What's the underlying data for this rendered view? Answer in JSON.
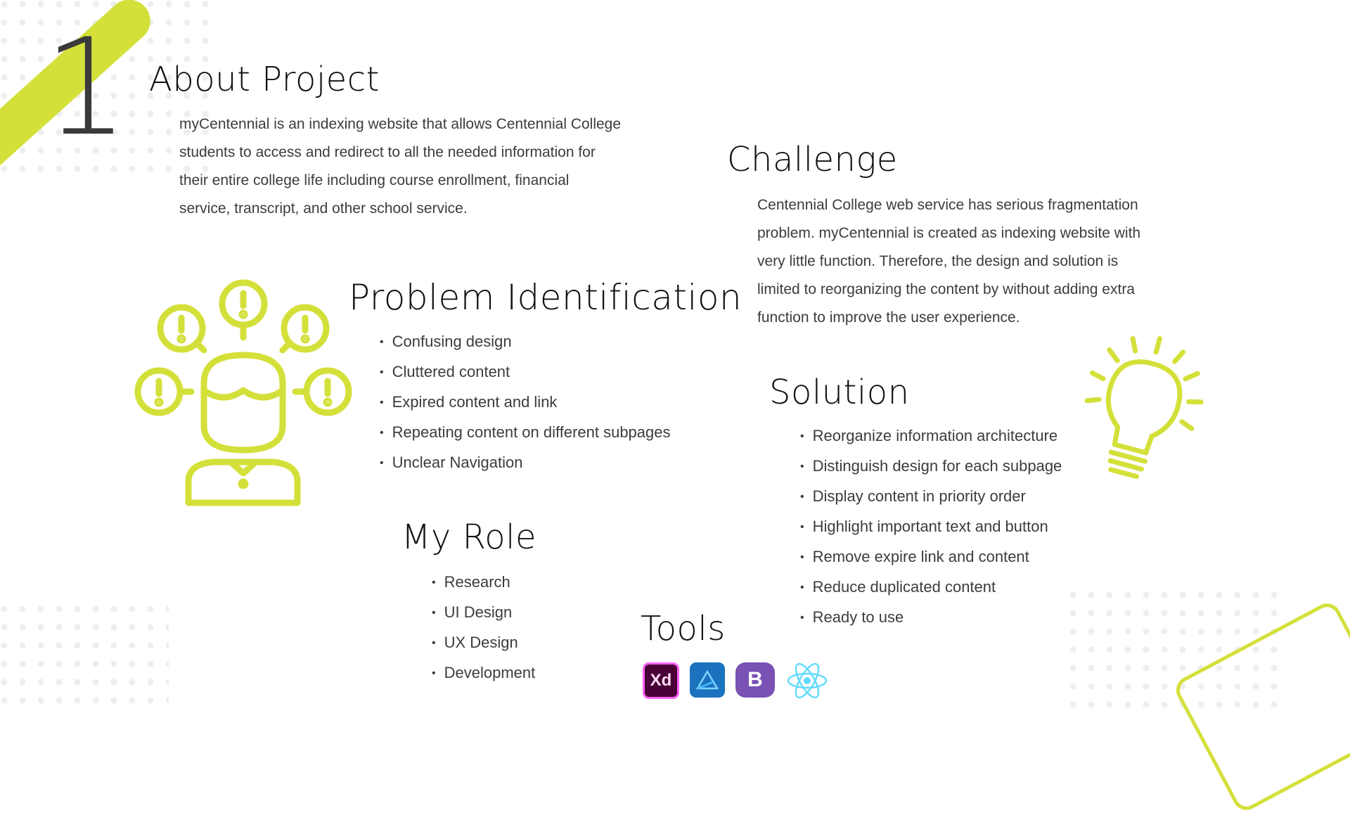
{
  "section_number": "1",
  "about": {
    "title": "About Project",
    "lines": [
      "myCentennial is an indexing website that allows Centennial College",
      "students to access and redirect to all the needed information for",
      "their entire college life including course enrollment, financial",
      "service, transcript, and other school service."
    ]
  },
  "challenge": {
    "title": "Challenge",
    "lines": [
      "Centennial College web service has serious fragmentation",
      "problem. myCentennial is created as indexing website with",
      "very little function. Therefore, the design and solution is",
      "limited to reorganizing the content by without adding extra",
      "function to improve the user experience."
    ]
  },
  "problem": {
    "title": "Problem Identification",
    "items": [
      "Confusing design",
      "Cluttered content",
      "Expired content and link",
      "Repeating content on different subpages",
      "Unclear Navigation"
    ]
  },
  "solution": {
    "title": "Solution",
    "items": [
      "Reorganize information architecture",
      "Distinguish design for each subpage",
      "Display content in priority order",
      "Highlight important text and button",
      "Remove expire link and content",
      "Reduce duplicated content",
      "Ready to use"
    ]
  },
  "role": {
    "title": "My Role",
    "items": [
      "Research",
      "UI Design",
      "UX Design",
      "Development"
    ]
  },
  "tools": {
    "title": "Tools",
    "icons": [
      {
        "name": "adobe-xd-icon",
        "label": "Xd"
      },
      {
        "name": "affinity-designer-icon",
        "label": ""
      },
      {
        "name": "bootstrap-icon",
        "label": "B"
      },
      {
        "name": "react-icon",
        "label": ""
      }
    ]
  },
  "colors": {
    "accent": "#d4e03a",
    "text": "#3c3c3c",
    "heading": "#111111"
  }
}
